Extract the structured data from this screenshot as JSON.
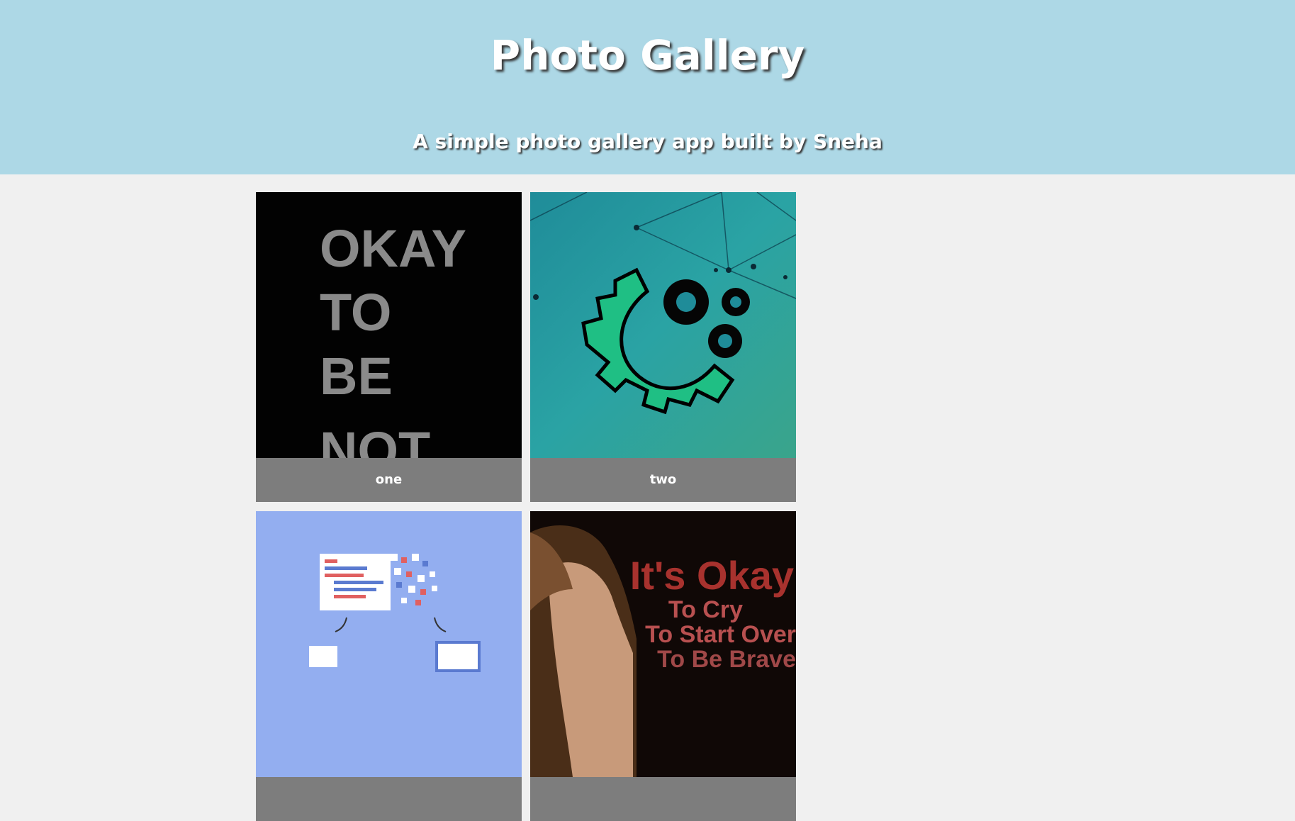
{
  "header": {
    "title": "Photo Gallery",
    "subtitle": "A simple photo gallery app built by Sneha"
  },
  "colors": {
    "header_bg": "#add8e6",
    "page_bg": "#f0f0f0",
    "caption_bg": "#7d7d7d"
  },
  "gallery": {
    "items": [
      {
        "caption": "one",
        "photo_lines": [
          "OKAY",
          "TO",
          "BE",
          "NOT"
        ]
      },
      {
        "caption": "two"
      },
      {
        "caption": ""
      },
      {
        "caption": "",
        "photo_lines": [
          "It's Okay",
          "To Cry",
          "To Start Over",
          "To Be Brave"
        ]
      }
    ]
  }
}
